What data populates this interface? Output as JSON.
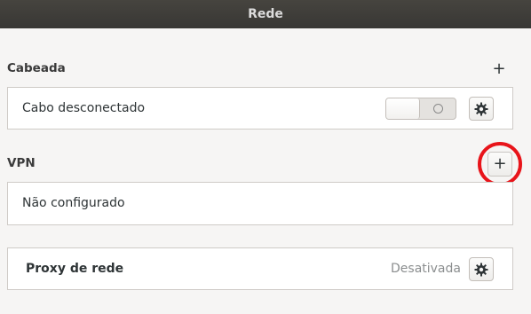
{
  "window": {
    "title": "Rede"
  },
  "wired": {
    "heading": "Cabeada",
    "add_icon": "plus-icon",
    "add_label": "+",
    "connection_label": "Cabo desconectado",
    "toggle_state": "off",
    "settings_icon": "gear-icon"
  },
  "vpn": {
    "heading": "VPN",
    "add_icon": "plus-icon",
    "add_label": "+",
    "empty_label": "Não configurado"
  },
  "proxy": {
    "label": "Proxy de rede",
    "status": "Desativada",
    "settings_icon": "gear-icon"
  },
  "annotation": {
    "color": "#e8141a"
  }
}
